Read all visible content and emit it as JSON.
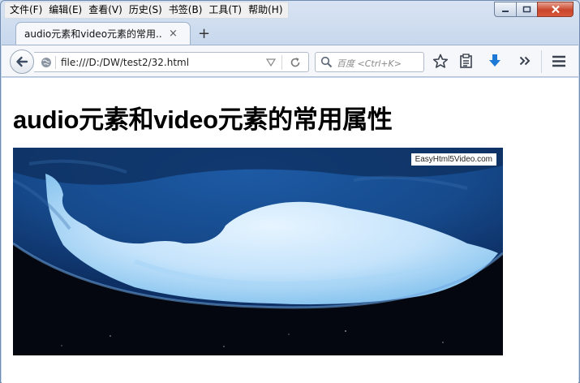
{
  "menu": [
    "文件(F)",
    "编辑(E)",
    "查看(V)",
    "历史(S)",
    "书签(B)",
    "工具(T)",
    "帮助(H)"
  ],
  "tab": {
    "title": "audio元素和video元素的常用...",
    "close": "×"
  },
  "new_tab": "+",
  "address": {
    "url": "file:///D:/DW/test2/32.html"
  },
  "search": {
    "placeholder": "百度 <Ctrl+K>"
  },
  "page": {
    "heading": "audio元素和video元素的常用属性"
  },
  "video": {
    "watermark": "EasyHtml5Video.com"
  },
  "icons": [
    "back-arrow-icon",
    "globe-icon",
    "reload-icon",
    "search-icon",
    "bookmark-star-icon",
    "reading-list-icon",
    "download-icon",
    "overflow-chevron-icon",
    "hamburger-menu-icon"
  ],
  "colors": {
    "download_arrow": "#1c7ad6",
    "close_button": "#c9452b",
    "frame": "#c6d6ec"
  }
}
